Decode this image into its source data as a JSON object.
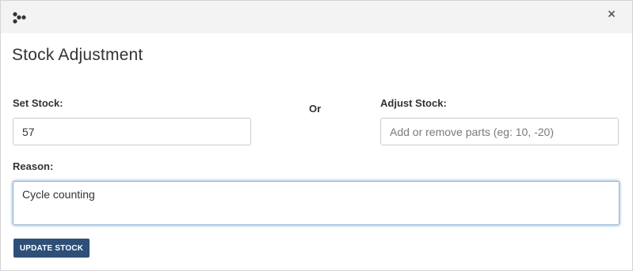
{
  "window": {
    "icon": "share-nodes-icon",
    "close_label": "×",
    "title": "Stock Adjustment"
  },
  "form": {
    "set_stock_label": "Set Stock:",
    "set_stock_value": "57",
    "or_label": "Or",
    "adjust_stock_label": "Adjust Stock:",
    "adjust_stock_placeholder": "Add or remove parts (eg: 10, -20)",
    "reason_label": "Reason:",
    "reason_value": "Cycle counting",
    "submit_label": "UPDATE STOCK"
  },
  "colors": {
    "topbar": "#f3f3f3",
    "button": "#2d4f78",
    "focus_border": "#8fb1d2"
  }
}
